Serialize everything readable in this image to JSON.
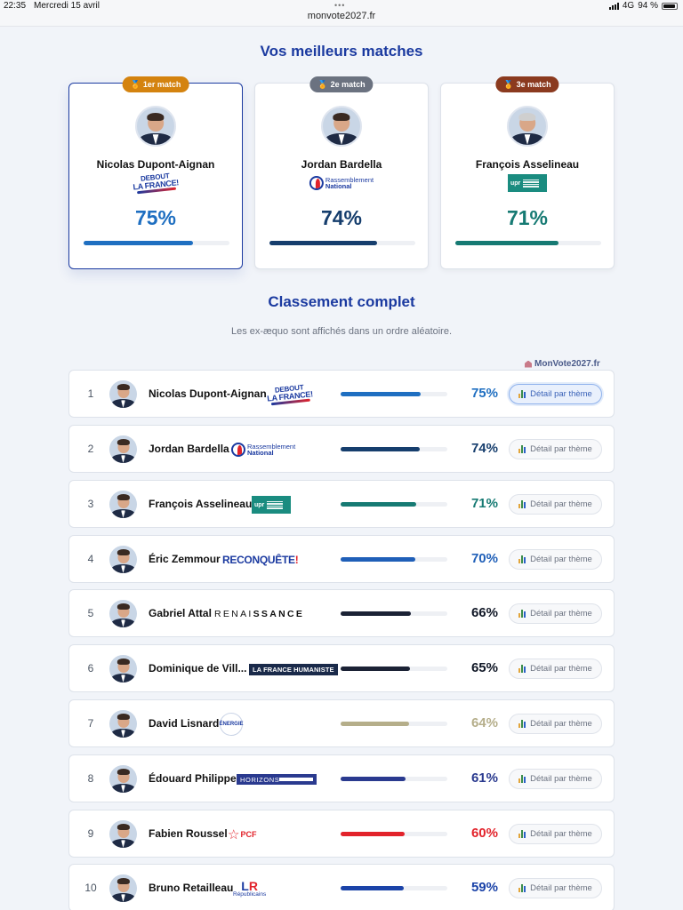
{
  "status_bar": {
    "time": "22:35",
    "date": "Mercredi 15 avril",
    "dots": "•••",
    "url": "monvote2027.fr",
    "network": "4G",
    "battery": "94 %"
  },
  "top_title": "Vos meilleurs matches",
  "top_matches": [
    {
      "badge": "1er match",
      "medal": "🏅",
      "badge_color": "#d4830f",
      "name": "Nicolas Dupont-Aignan",
      "party": "DEBOUT LA FRANCE!",
      "logo": "dlf",
      "percent_label": "75%",
      "percent": 75,
      "color": "#1f6fc1"
    },
    {
      "badge": "2e match",
      "medal": "🏅",
      "badge_color": "#6b7280",
      "name": "Jordan Bardella",
      "party": "Rassemblement National",
      "logo": "rn",
      "percent_label": "74%",
      "percent": 74,
      "color": "#163e6d"
    },
    {
      "badge": "3e match",
      "medal": "🏅",
      "badge_color": "#8b3a1f",
      "name": "François Asselineau",
      "party": "UPR",
      "logo": "upr",
      "percent_label": "71%",
      "percent": 71,
      "color": "#167a73"
    }
  ],
  "ranking_title": "Classement complet",
  "ranking_note": "Les ex-æquo sont affichés dans un ordre aléatoire.",
  "watermark": "MonVote2027.fr",
  "detail_label": "Détail par thème",
  "ranking": [
    {
      "rank": "1",
      "name": "Nicolas Dupont-Aignan",
      "party": "DEBOUT LA FRANCE!",
      "logo": "dlf",
      "percent_label": "75%",
      "percent": 75,
      "color": "#1f6fc1",
      "pct_color": "#1f6fc1",
      "active": true
    },
    {
      "rank": "2",
      "name": "Jordan Bardella",
      "party": "Rassemblement National",
      "logo": "rn",
      "percent_label": "74%",
      "percent": 74,
      "color": "#163e6d",
      "pct_color": "#163e6d",
      "active": false
    },
    {
      "rank": "3",
      "name": "François Asselineau",
      "party": "UPR",
      "logo": "upr",
      "percent_label": "71%",
      "percent": 71,
      "color": "#167a73",
      "pct_color": "#167a73",
      "active": false
    },
    {
      "rank": "4",
      "name": "Éric Zemmour",
      "party": "RECONQUÊTE!",
      "logo": "rec",
      "percent_label": "70%",
      "percent": 70,
      "color": "#1f5fb8",
      "pct_color": "#1f5fb8",
      "active": false
    },
    {
      "rank": "5",
      "name": "Gabriel Attal",
      "party": "RENAISSANCE",
      "logo": "ren",
      "percent_label": "66%",
      "percent": 66,
      "color": "#1b2235",
      "pct_color": "#111827",
      "active": false
    },
    {
      "rank": "6",
      "name": "Dominique de Vill...",
      "party": "LA FRANCE HUMANISTE",
      "logo": "lfh",
      "percent_label": "65%",
      "percent": 65,
      "color": "#1b2235",
      "pct_color": "#111827",
      "active": false
    },
    {
      "rank": "7",
      "name": "David Lisnard",
      "party": "ÉNERGIE",
      "logo": "energie",
      "percent_label": "64%",
      "percent": 64,
      "color": "#b5ae8a",
      "pct_color": "#b5ae8a",
      "active": false
    },
    {
      "rank": "8",
      "name": "Édouard Philippe",
      "party": "HORIZONS",
      "logo": "hor",
      "percent_label": "61%",
      "percent": 61,
      "color": "#2a3a8f",
      "pct_color": "#2a3a8f",
      "active": false
    },
    {
      "rank": "9",
      "name": "Fabien Roussel",
      "party": "PCF",
      "logo": "pcf",
      "percent_label": "60%",
      "percent": 60,
      "color": "#e2232b",
      "pct_color": "#e2232b",
      "active": false
    },
    {
      "rank": "10",
      "name": "Bruno Retailleau",
      "party": "Les Républicains",
      "logo": "lr",
      "percent_label": "59%",
      "percent": 59,
      "color": "#1b43a8",
      "pct_color": "#1b43a8",
      "active": false
    }
  ]
}
